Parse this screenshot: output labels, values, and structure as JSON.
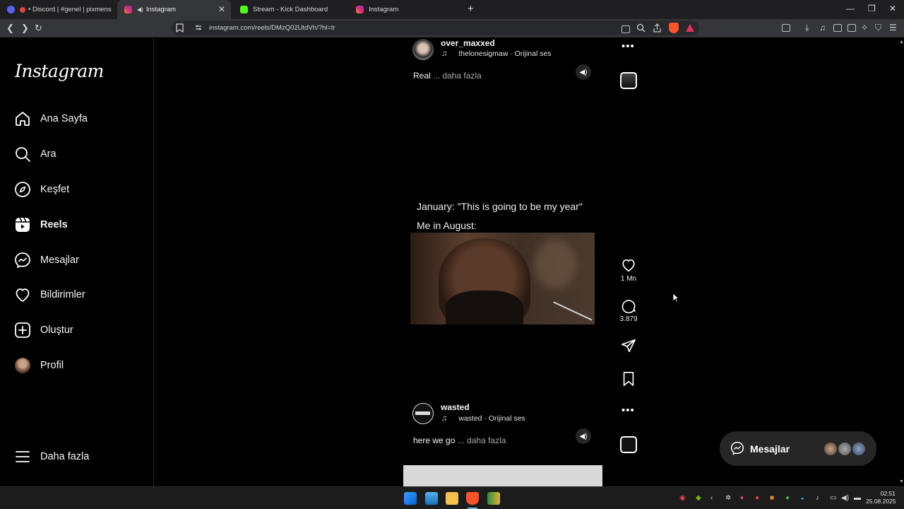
{
  "browser": {
    "tabs": [
      {
        "title": "• Discord | #genel | pixmens",
        "active": false,
        "favicon_color": "#5865F2"
      },
      {
        "title": "Instagram",
        "active": true,
        "favicon_color": "#e1306c"
      },
      {
        "title": "Stream - Kick Dashboard",
        "active": false,
        "favicon_color": "#53fc18"
      },
      {
        "title": "Instagram",
        "active": false,
        "favicon_color": "#e1306c"
      }
    ],
    "new_tab": "+",
    "url": "instagram.com/reels/DMzQ02UtdVh/?hl=tr"
  },
  "sidebar": {
    "logo": "Instagram",
    "items": [
      {
        "label": "Ana Sayfa",
        "icon": "home-icon"
      },
      {
        "label": "Ara",
        "icon": "search-icon"
      },
      {
        "label": "Keşfet",
        "icon": "compass-icon"
      },
      {
        "label": "Reels",
        "icon": "reels-icon",
        "active": true
      },
      {
        "label": "Mesajlar",
        "icon": "messenger-icon"
      },
      {
        "label": "Bildirimler",
        "icon": "heart-icon"
      },
      {
        "label": "Oluştur",
        "icon": "plus-square-icon"
      },
      {
        "label": "Profil",
        "icon": "avatar"
      }
    ],
    "more": "Daha fazla"
  },
  "reel_top": {
    "username": "over_maxxed",
    "audio": "thelonesigmaw · Orijinal ses",
    "caption": "Real",
    "more": "... daha fazla"
  },
  "reel_main": {
    "meme_line1": "January: \"This is going to be my year\"",
    "meme_line2": "Me in August:",
    "likes": "1 Mn",
    "comments": "3.879"
  },
  "reel_bottom": {
    "username": "wasted",
    "audio": "wasted · Orijinal ses",
    "caption": "here we go",
    "more": "... daha fazla"
  },
  "messages_pill": {
    "label": "Mesajlar"
  },
  "taskbar": {
    "time": "02:51",
    "date": "25.08.2025"
  },
  "colors": {
    "background": "#000000",
    "text": "#f5f5f5",
    "muted": "#a8a8a8",
    "tab_active": "#35363a",
    "pill": "#262626"
  }
}
